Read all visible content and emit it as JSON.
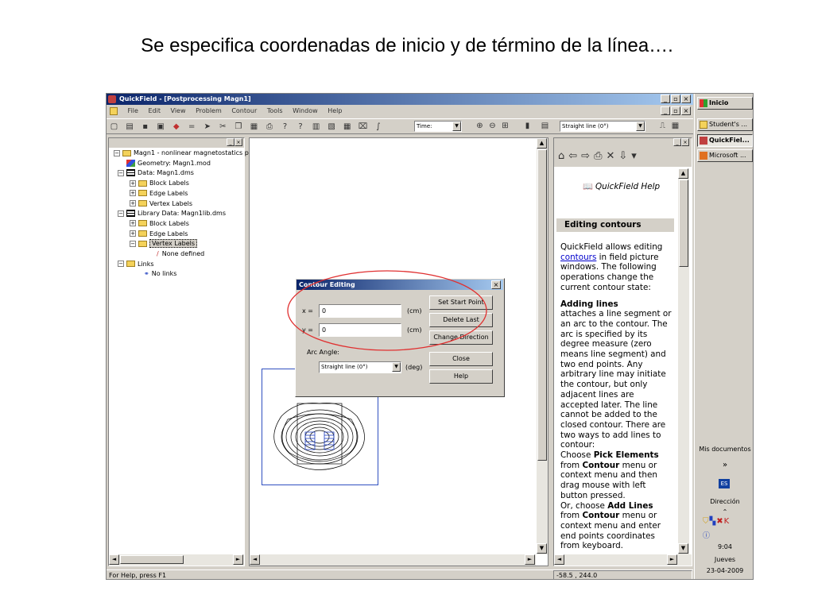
{
  "slide": {
    "title": "Se especifica coordenadas de inicio y de término de la línea…."
  },
  "window": {
    "title": "QuickField - [Postprocessing Magn1]",
    "menu": [
      "File",
      "Edit",
      "View",
      "Problem",
      "Contour",
      "Tools",
      "Window",
      "Help"
    ],
    "time_label": "Time:",
    "arc_combo": "Straight line (0°)"
  },
  "tree": {
    "items": [
      {
        "label": "Magn1 - nonlinear magnetostatics p"
      },
      {
        "label": "Geometry: Magn1.mod"
      },
      {
        "label": "Data: Magn1.dms"
      },
      {
        "label": "Block Labels"
      },
      {
        "label": "Edge Labels"
      },
      {
        "label": "Vertex Labels"
      },
      {
        "label": "Library Data: Magn1lib.dms"
      },
      {
        "label": "Block Labels"
      },
      {
        "label": "Edge Labels"
      },
      {
        "label": "Vertex Labels"
      },
      {
        "label": "None defined"
      },
      {
        "label": "Links"
      },
      {
        "label": "No links"
      }
    ]
  },
  "dialog": {
    "title": "Contour Editing",
    "x_label": "x =",
    "x_value": "0",
    "y_label": "y =",
    "y_value": "0",
    "unit": "(cm)",
    "arc_label": "Arc Angle:",
    "arc_value": "Straight line (0°)",
    "arc_unit": "(deg)",
    "buttons": {
      "set_start": "Set Start Point",
      "delete_last": "Delete Last",
      "change_direction": "Change Direction",
      "close": "Close",
      "help": "Help"
    }
  },
  "help": {
    "logo": "QuickField Help",
    "heading": "Editing contours",
    "p1_a": "QuickField allows editing",
    "p1_link": "contours",
    "p1_b": "in field picture windows. The following operations change the current contour state:",
    "sub": "Adding lines",
    "p2": "attaches a line segment or an arc to the contour. The arc is specified by its degree measure (zero means line segment) and two end points. Any arbitrary line may initiate the contour, but only adjacent lines are accepted later. The line cannot be added to the closed contour. There are two ways to add lines to contour:",
    "p3_a": "Choose",
    "p3_b": "Pick Elements",
    "p3_c": "from",
    "p3_d": "Contour",
    "p3_e": "menu or context menu and then drag mouse with left button pressed.",
    "p4_a": "Or, choose",
    "p4_b": "Add Lines",
    "p4_c": "from",
    "p4_d": "Contour",
    "p4_e": "menu or context menu and enter end points coordinates from keyboard."
  },
  "status": {
    "left": "For Help, press F1",
    "coords": "-58.5 , 244.0"
  },
  "taskbar": {
    "start": "Inicio",
    "items": [
      "Student's ...",
      "QuickFiel...",
      "Microsoft ..."
    ],
    "mis_documentos": "Mis documentos",
    "chevron": "»",
    "lang": "ES",
    "direccion": "Dirección",
    "time": "9:04",
    "day": "Jueves",
    "date": "23-04-2009"
  },
  "colors": {
    "title_gradient_start": "#0a246a",
    "title_gradient_end": "#a6caf0",
    "highlight_ellipse": "#e03030",
    "chrome": "#d4d0c8"
  }
}
